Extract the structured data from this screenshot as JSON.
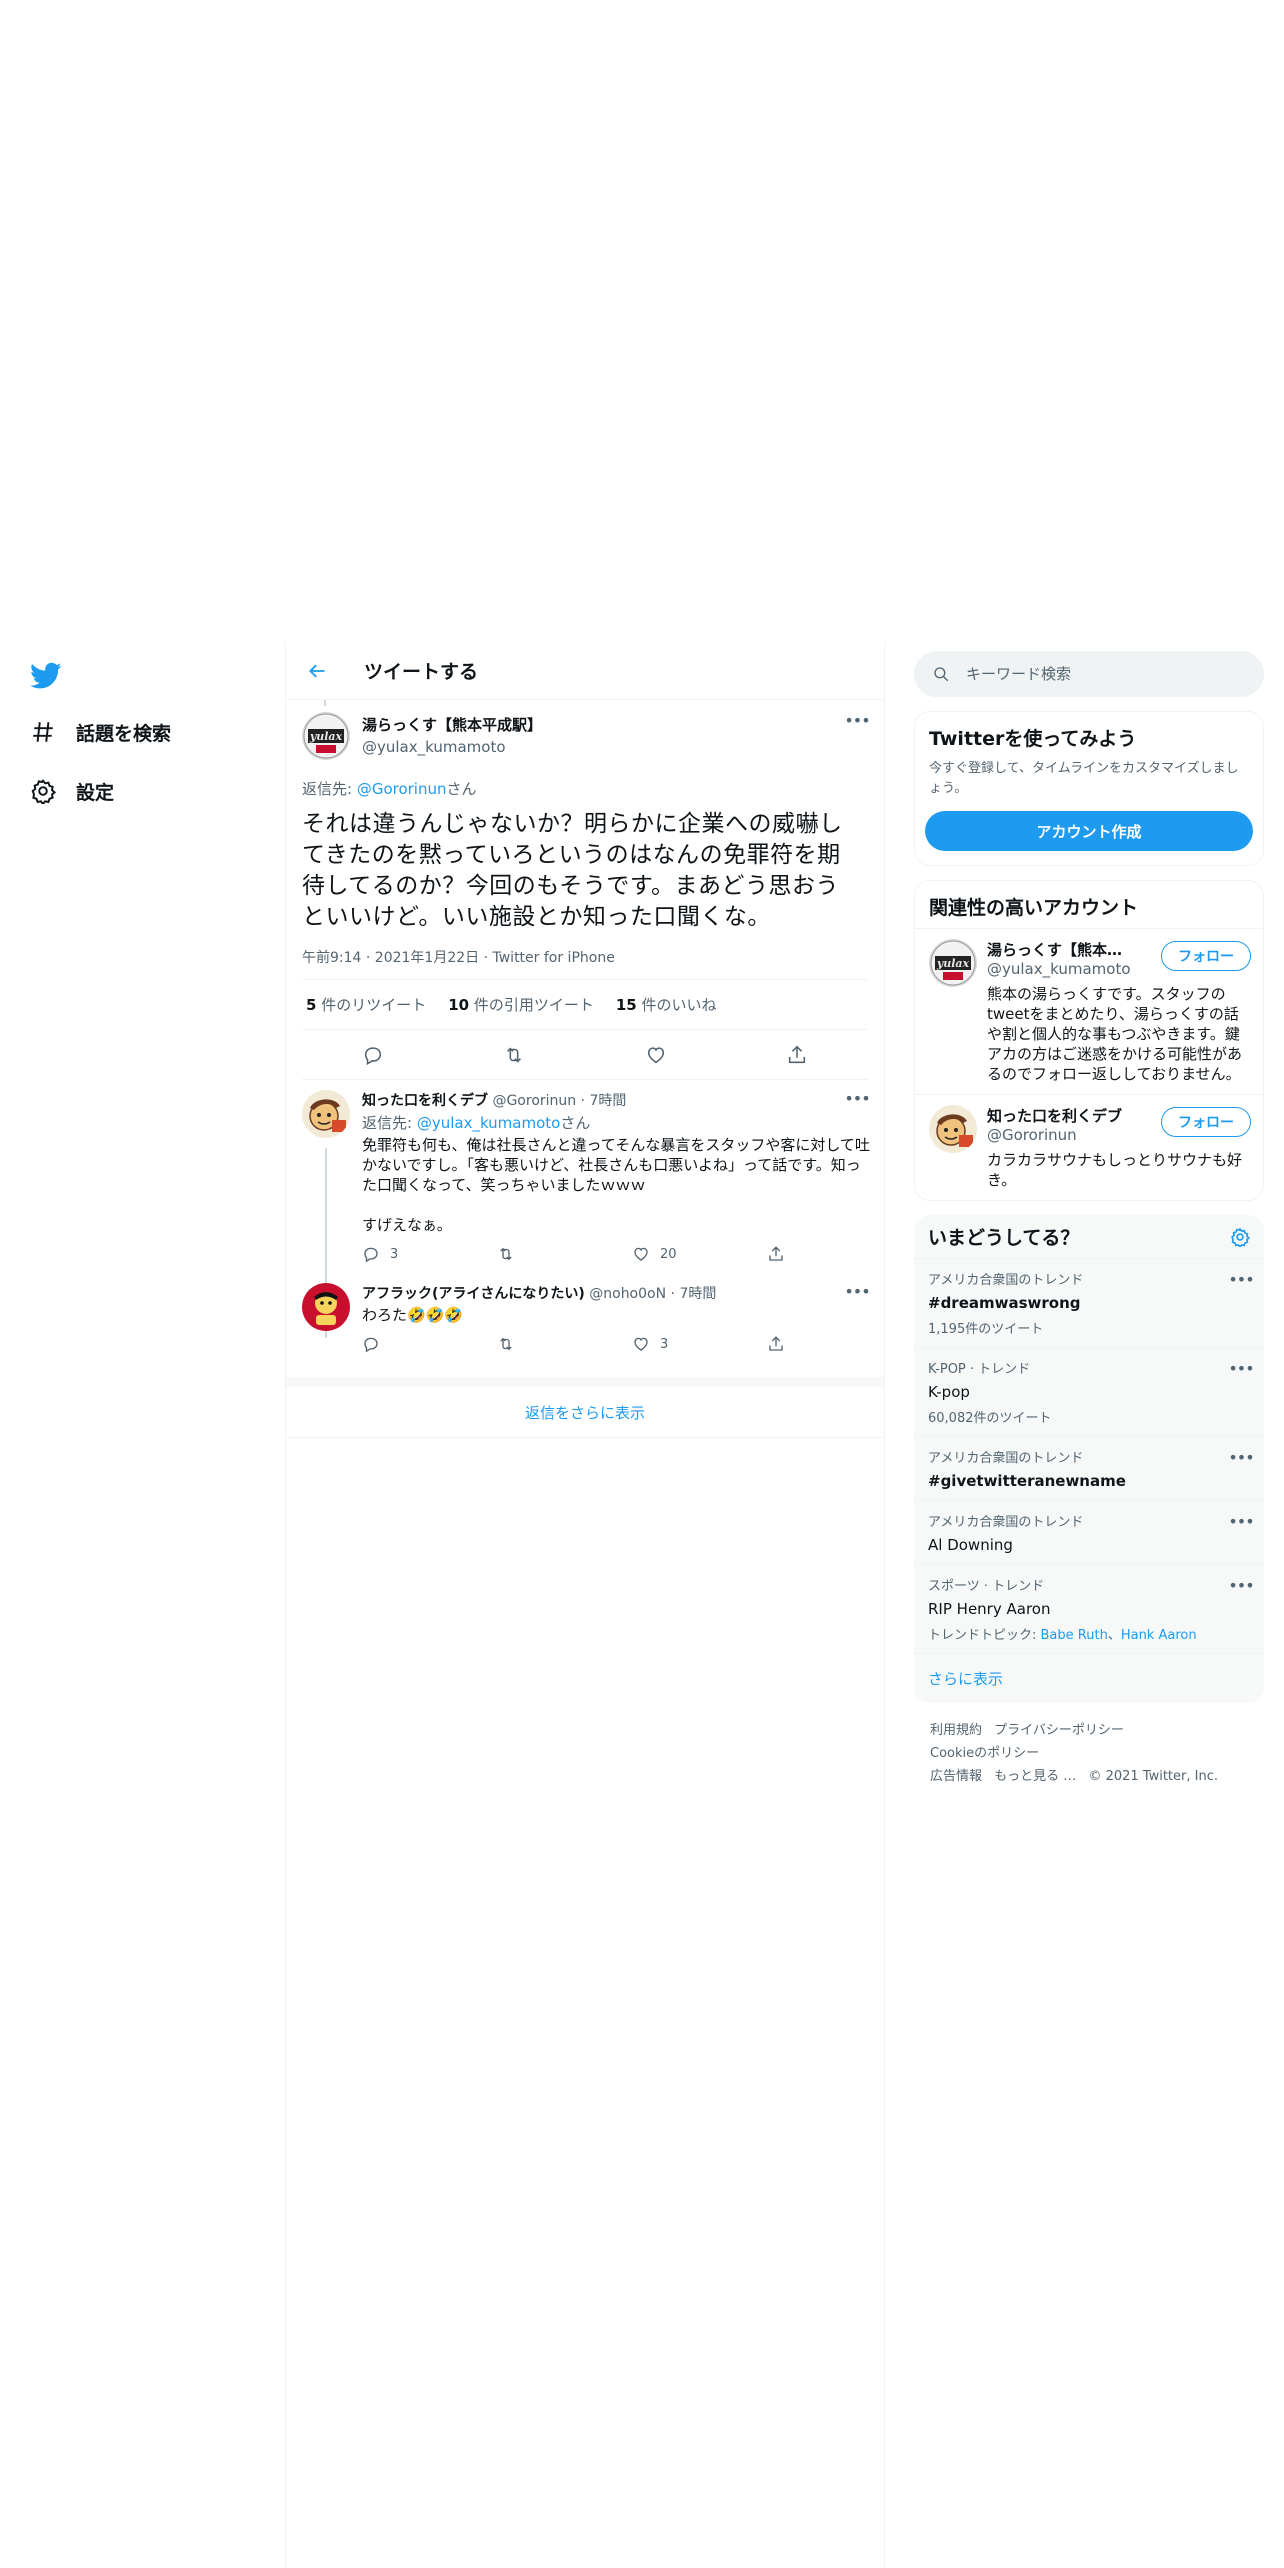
{
  "nav": {
    "explore_label": "話題を検索",
    "settings_label": "設定"
  },
  "header": {
    "title": "ツイートする"
  },
  "main_tweet": {
    "author_name": "湯らっくす【熊本平成駅】",
    "author_handle": "@yulax_kumamoto",
    "reply_prefix": "返信先: ",
    "reply_handle": "@Gororinun",
    "reply_suffix": "さん",
    "text": "それは違うんじゃないか？明らかに企業への威嚇してきたのを黙っていろというのはなんの免罪符を期待してるのか？今回のもそうです。まあどう思おうといいけど。いい施設とか知った口聞くな。",
    "timestamp": "午前9:14 · 2021年1月22日 · Twitter for iPhone",
    "retweets_count": "5",
    "retweets_label": " 件のリツイート",
    "quotes_count": "10",
    "quotes_label": " 件の引用ツイート",
    "likes_count": "15",
    "likes_label": " 件のいいね"
  },
  "replies": [
    {
      "name": "知った口を利くデブ",
      "handle": "@Gororinun",
      "time": "7時間",
      "reply_prefix": "返信先: ",
      "reply_handle": "@yulax_kumamoto",
      "reply_suffix": "さん",
      "text": "免罪符も何も、俺は社長さんと違ってそんな暴言をスタッフや客に対して吐かないですし。「客も悪いけど、社長さんも口悪いよね」って話です。知った口聞くなって、笑っちゃいましたｗｗｗ\n\nすげえなぁ。",
      "reply_count": "3",
      "retweet_count": "",
      "like_count": "20"
    },
    {
      "name": "アフラック(アライさんになりたい)",
      "handle": "@noho0oN",
      "time": "7時間",
      "text": "わろた🤣🤣🤣",
      "reply_count": "",
      "retweet_count": "",
      "like_count": "3"
    }
  ],
  "show_more_replies": "返信をさらに表示",
  "search": {
    "placeholder": "キーワード検索"
  },
  "signup": {
    "title": "Twitterを使ってみよう",
    "desc": "今すぐ登録して、タイムラインをカスタマイズしましょう。",
    "button": "アカウント作成"
  },
  "related": {
    "title": "関連性の高いアカウント",
    "follow_label": "フォロー",
    "accounts": [
      {
        "name": "湯らっくす【熊本平成駅】",
        "handle": "@yulax_kumamoto",
        "bio": "熊本の湯らっくすです。スタッフのtweetをまとめたり、湯らっくすの話や割と個人的な事もつぶやきます。鍵アカの方はご迷惑をかける可能性があるのでフォロー返ししておりません。"
      },
      {
        "name": "知った口を利くデブ",
        "handle": "@Gororinun",
        "bio": "カラカラサウナもしっとりサウナも好き。"
      }
    ]
  },
  "trends": {
    "title": "いまどうしてる？",
    "items": [
      {
        "meta": "アメリカ合衆国のトレンド",
        "name": "#dreamwaswrong",
        "count": "1,195件のツイート"
      },
      {
        "meta": "K-POP · トレンド",
        "name": "K-pop",
        "count": "60,082件のツイート"
      },
      {
        "meta": "アメリカ合衆国のトレンド",
        "name": "#givetwitteranewname",
        "count": ""
      },
      {
        "meta": "アメリカ合衆国のトレンド",
        "name": "Al Downing",
        "count": ""
      },
      {
        "meta": "スポーツ · トレンド",
        "name": "RIP Henry Aaron",
        "topics_label": "トレンドトピック: ",
        "topic_1": "Babe Ruth",
        "topic_sep": "、",
        "topic_2": "Hank Aaron"
      }
    ],
    "show_more": "さらに表示"
  },
  "footer": {
    "links": [
      "利用規約",
      "プライバシーポリシー",
      "Cookieのポリシー",
      "広告情報",
      "もっと見る …",
      "© 2021 Twitter, Inc."
    ]
  },
  "colors": {
    "accent": "#1d9bf0",
    "secondary_text": "#536471",
    "border": "#eff3f4"
  }
}
